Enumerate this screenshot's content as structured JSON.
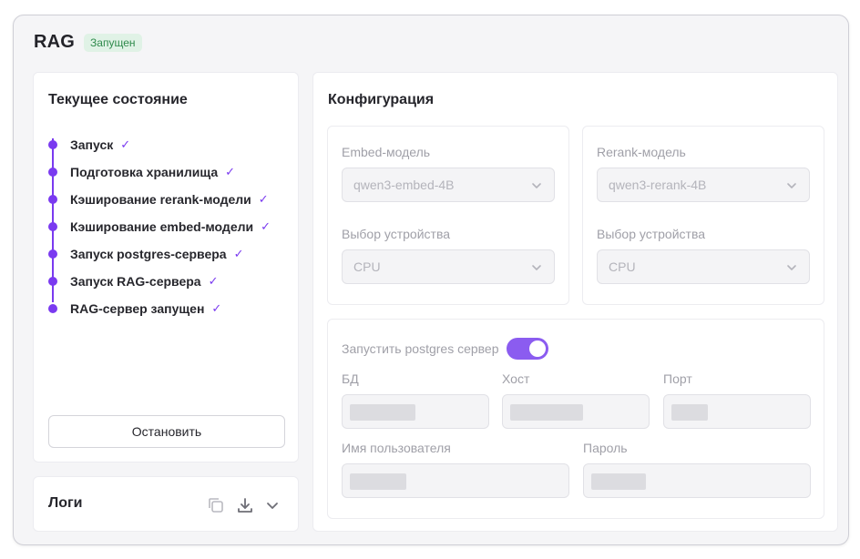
{
  "header": {
    "title": "RAG",
    "badge": "Запущен"
  },
  "status": {
    "title": "Текущее состояние",
    "steps": [
      {
        "label": "Запуск"
      },
      {
        "label": "Подготовка хранилища"
      },
      {
        "label": "Кэширование rerank-модели"
      },
      {
        "label": "Кэширование embed-модели"
      },
      {
        "label": "Запуск postgres-сервера"
      },
      {
        "label": "Запуск RAG-сервера"
      },
      {
        "label": "RAG-сервер запущен"
      }
    ],
    "stop_label": "Остановить"
  },
  "logs": {
    "title": "Логи",
    "icons": [
      "copy-icon",
      "download-icon",
      "chevron-down-icon"
    ]
  },
  "config": {
    "title": "Конфигурация",
    "embed": {
      "model_label": "Embed-модель",
      "model_value": "qwen3-embed-4B",
      "device_label": "Выбор устройства",
      "device_value": "CPU"
    },
    "rerank": {
      "model_label": "Rerank-модель",
      "model_value": "qwen3-rerank-4B",
      "device_label": "Выбор устройства",
      "device_value": "CPU"
    },
    "postgres": {
      "toggle_label": "Запустить postgres сервер",
      "toggle_on": true,
      "db_label": "БД",
      "host_label": "Хост",
      "port_label": "Порт",
      "user_label": "Имя пользователя",
      "password_label": "Пароль"
    }
  },
  "colors": {
    "accent": "#7a3af0",
    "badge_bg": "#e0f2e6",
    "badge_text": "#2f8a4c"
  }
}
